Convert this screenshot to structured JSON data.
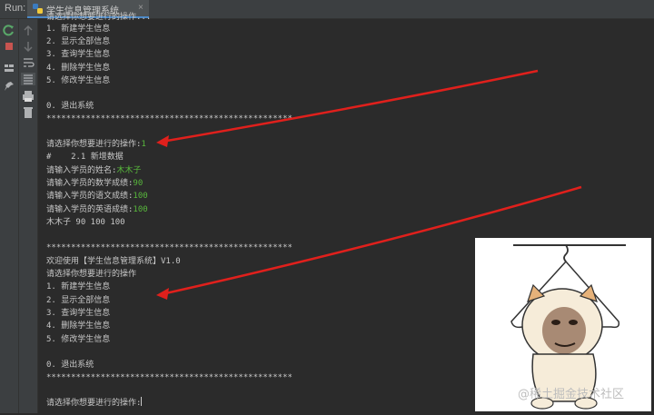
{
  "run_bar": {
    "label": "Run:",
    "tab_title": "学生信息管理系统",
    "tab_close": "×"
  },
  "toolbar": {
    "icons": [
      "rerun-icon",
      "stop-icon",
      "layout-icon",
      "pin-icon"
    ],
    "icons2": [
      "up-arrow-icon",
      "down-arrow-icon",
      "soft-wrap-icon",
      "scroll-to-end-icon",
      "print-icon",
      "trash-icon"
    ]
  },
  "console": {
    "top_clipped": "请选择你想要进行的操作...",
    "menu": [
      "1. 新建学生信息",
      "2. 显示全部信息",
      "3. 查询学生信息",
      "4. 删除学生信息",
      "5. 修改学生信息"
    ],
    "exit": "0. 退出系统",
    "separator": "**************************************************",
    "prompt": "请选择你想要进行的操作:",
    "prompt_input": "1",
    "section_heading": "#    2.1 新增数据",
    "name_prompt": "请输入学员的姓名:",
    "name_input": "木木子",
    "math_prompt": "请输入学员的数学成绩:",
    "math_input": "90",
    "chinese_prompt": "请输入学员的语文成绩:",
    "chinese_input": "100",
    "english_prompt": "请输入学员的英语成绩:",
    "english_input": "100",
    "result": "木木子 90 100 100",
    "welcome": "欢迎使用【学生信息管理系统】V1.0",
    "choose": "请选择你想要进行的操作",
    "prompt_final": "请选择你想要进行的操作:"
  },
  "watermark": "@稀土掘金技术社区",
  "colors": {
    "background": "#2b2b2b",
    "text": "#c8c8c8",
    "user_input": "#58b83c",
    "arrow": "#e0201c"
  }
}
